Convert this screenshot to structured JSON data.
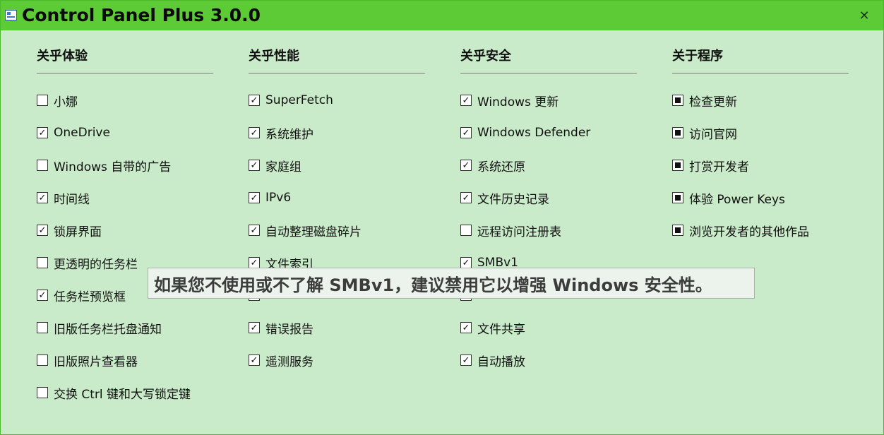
{
  "window": {
    "title": "Control Panel Plus 3.0.0",
    "close_glyph": "✕"
  },
  "columns": [
    {
      "header": "关乎体验",
      "items": [
        {
          "label": "小娜",
          "checked": false
        },
        {
          "label": "OneDrive",
          "checked": true
        },
        {
          "label": "Windows 自带的广告",
          "checked": false
        },
        {
          "label": "时间线",
          "checked": true
        },
        {
          "label": "锁屏界面",
          "checked": true
        },
        {
          "label": "更透明的任务栏",
          "checked": false
        },
        {
          "label": "任务栏预览框",
          "checked": true
        },
        {
          "label": "旧版任务栏托盘通知",
          "checked": false
        },
        {
          "label": "旧版照片查看器",
          "checked": false
        },
        {
          "label": "交换 Ctrl 键和大写锁定键",
          "checked": false
        }
      ]
    },
    {
      "header": "关乎性能",
      "items": [
        {
          "label": "SuperFetch",
          "checked": true
        },
        {
          "label": "系统维护",
          "checked": true
        },
        {
          "label": "家庭组",
          "checked": true
        },
        {
          "label": "IPv6",
          "checked": true
        },
        {
          "label": "自动整理磁盘碎片",
          "checked": true
        },
        {
          "label": "文件索引",
          "checked": true
        },
        {
          "label": "",
          "checked": false
        },
        {
          "label": "错误报告",
          "checked": true
        },
        {
          "label": "遥测服务",
          "checked": true
        }
      ]
    },
    {
      "header": "关乎安全",
      "items": [
        {
          "label": "Windows 更新",
          "checked": true
        },
        {
          "label": "Windows Defender",
          "checked": true
        },
        {
          "label": "系统还原",
          "checked": true
        },
        {
          "label": "文件历史记录",
          "checked": true
        },
        {
          "label": "远程访问注册表",
          "checked": false
        },
        {
          "label": "SMBv1",
          "checked": true
        },
        {
          "label": "",
          "checked": false
        },
        {
          "label": "文件共享",
          "checked": true
        },
        {
          "label": "自动播放",
          "checked": true
        }
      ]
    },
    {
      "header": "关于程序",
      "items": [
        {
          "label": "检查更新"
        },
        {
          "label": "访问官网"
        },
        {
          "label": "打赏开发者"
        },
        {
          "label": "体验 Power Keys"
        },
        {
          "label": "浏览开发者的其他作品"
        }
      ]
    }
  ],
  "tooltip": {
    "text": "如果您不使用或不了解 SMBv1，建议禁用它以增强 Windows 安全性。"
  }
}
